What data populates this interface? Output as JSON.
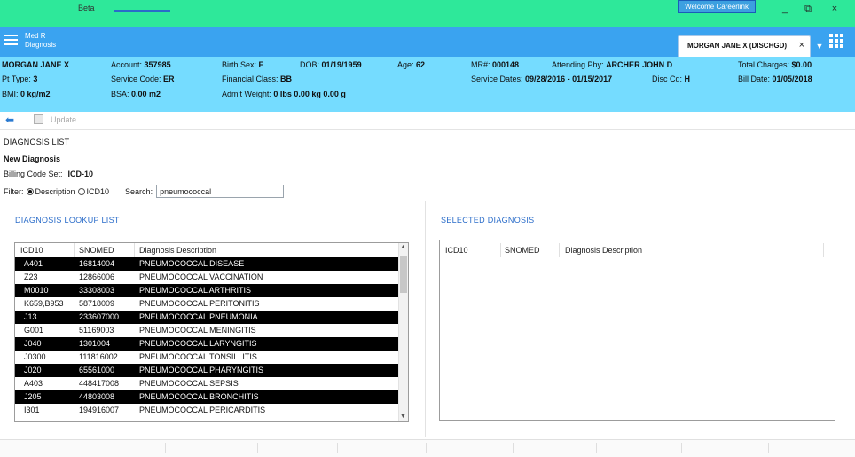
{
  "titlebar": {
    "app_label": "Beta",
    "user_label": "Welcome Careerlink",
    "minimize": "_",
    "restore": "⧉",
    "close": "×"
  },
  "module": {
    "title_line1": "Med R",
    "title_line2": "Diagnosis"
  },
  "patient_tab": {
    "label": "MORGAN JANE X (DISCHGD)",
    "close": "×"
  },
  "banner": {
    "name": "MORGAN JANE X",
    "account_label": "Account:",
    "account": "357985",
    "birth_sex_label": "Birth Sex:",
    "birth_sex": "F",
    "dob_label": "DOB:",
    "dob": "01/19/1959",
    "age_label": "Age:",
    "age": "62",
    "mr_label": "MR#:",
    "mr": "000148",
    "attending_label": "Attending Phy:",
    "attending": "ARCHER JOHN D",
    "total_charges_label": "Total Charges:",
    "total_charges": "$0.00",
    "pt_type_label": "Pt Type:",
    "pt_type": "3",
    "service_code_label": "Service Code:",
    "service_code": "ER",
    "financial_class_label": "Financial Class:",
    "financial_class": "BB",
    "service_dates_label": "Service Dates:",
    "service_dates": "09/28/2016 - 01/15/2017",
    "disc_cd_label": "Disc Cd:",
    "disc_cd": "H",
    "bill_date_label": "Bill Date:",
    "bill_date": "01/05/2018",
    "bmi_label": "BMI:",
    "bmi": "0 kg/m2",
    "bsa_label": "BSA:",
    "bsa": "0.00 m2",
    "admit_weight_label": "Admit Weight:",
    "admit_weight": "0 lbs 0.00 kg 0.00 g"
  },
  "toolbar": {
    "back_icon": "⬅",
    "update_label": "Update"
  },
  "page": {
    "section_title": "DIAGNOSIS LIST",
    "new_diagnosis": "New Diagnosis",
    "billing_code_label": "Billing Code Set:",
    "billing_code_value": "ICD-10",
    "filter_label": "Filter:",
    "filter_opt_description": "Description",
    "filter_opt_icd10": "ICD10",
    "search_label": "Search:",
    "search_value": "pneumococcal"
  },
  "lookup": {
    "title": "DIAGNOSIS LOOKUP LIST",
    "columns": [
      "ICD10",
      "SNOMED",
      "Diagnosis Description"
    ],
    "rows": [
      {
        "icd": "A401",
        "snomed": "16814004",
        "desc": "PNEUMOCOCCAL DISEASE",
        "style": "dark"
      },
      {
        "icd": "Z23",
        "snomed": "12866006",
        "desc": "PNEUMOCOCCAL VACCINATION",
        "style": "light"
      },
      {
        "icd": "M0010",
        "snomed": "33308003",
        "desc": "PNEUMOCOCCAL ARTHRITIS",
        "style": "dark"
      },
      {
        "icd": "K659,B953",
        "snomed": "58718009",
        "desc": "PNEUMOCOCCAL PERITONITIS",
        "style": "light"
      },
      {
        "icd": "J13",
        "snomed": "233607000",
        "desc": "PNEUMOCOCCAL PNEUMONIA",
        "style": "dark"
      },
      {
        "icd": "G001",
        "snomed": "51169003",
        "desc": "PNEUMOCOCCAL MENINGITIS",
        "style": "light"
      },
      {
        "icd": "J040",
        "snomed": "1301004",
        "desc": "PNEUMOCOCCAL LARYNGITIS",
        "style": "dark"
      },
      {
        "icd": "J0300",
        "snomed": "111816002",
        "desc": "PNEUMOCOCCAL TONSILLITIS",
        "style": "light"
      },
      {
        "icd": "J020",
        "snomed": "65561000",
        "desc": "PNEUMOCOCCAL PHARYNGITIS",
        "style": "dark"
      },
      {
        "icd": "A403",
        "snomed": "448417008",
        "desc": "PNEUMOCOCCAL SEPSIS",
        "style": "light"
      },
      {
        "icd": "J205",
        "snomed": "44803008",
        "desc": "PNEUMOCOCCAL BRONCHITIS",
        "style": "dark"
      },
      {
        "icd": "I301",
        "snomed": "194916007",
        "desc": "PNEUMOCOCCAL PERICARDITIS",
        "style": "light"
      }
    ]
  },
  "selected": {
    "title": "SELECTED DIAGNOSIS",
    "columns": [
      "ICD10",
      "SNOMED",
      "Diagnosis Description"
    ]
  }
}
